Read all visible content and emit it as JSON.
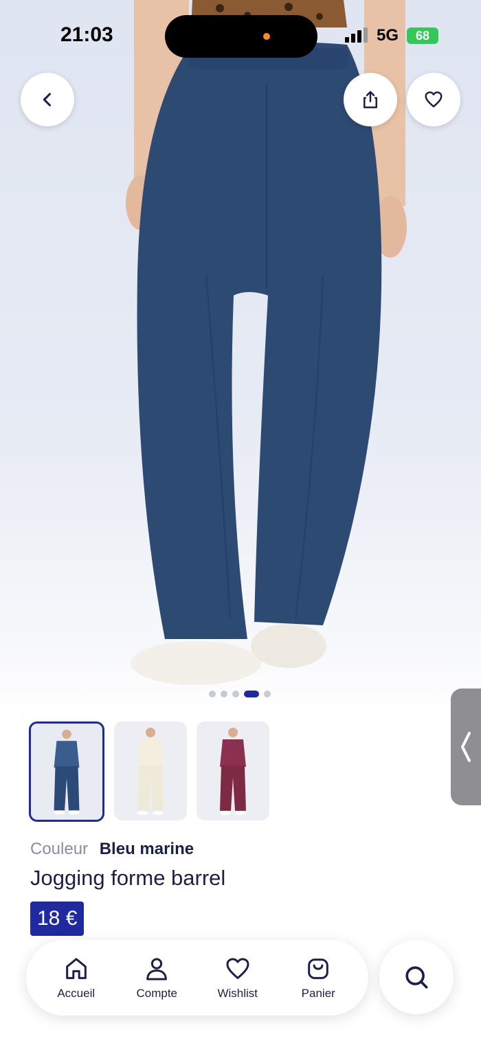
{
  "status_bar": {
    "time": "21:03",
    "network": "5G",
    "battery": "68"
  },
  "header": {
    "back_icon": "chevron-left-icon",
    "share_icon": "share-icon",
    "wishlist_icon": "heart-icon"
  },
  "gallery": {
    "total_slides": 5,
    "active_slide": 4
  },
  "variants": [
    {
      "name": "navy",
      "color": "#2b4a78",
      "top": "#3a5c8f",
      "selected": true
    },
    {
      "name": "cream",
      "color": "#efe9d8",
      "top": "#f3eede",
      "selected": false
    },
    {
      "name": "burgundy",
      "color": "#7e2a45",
      "top": "#8b3050",
      "selected": false
    }
  ],
  "product": {
    "color_label": "Couleur",
    "color_value": "Bleu marine",
    "title": "Jogging forme barrel",
    "price": "18 €"
  },
  "nav": {
    "items": [
      {
        "label": "Accueil",
        "icon": "home-icon"
      },
      {
        "label": "Compte",
        "icon": "user-icon"
      },
      {
        "label": "Wishlist",
        "icon": "heart-icon"
      },
      {
        "label": "Panier",
        "icon": "bag-icon"
      }
    ],
    "search_icon": "search-icon"
  },
  "colors": {
    "accent": "#1f2a9e",
    "text": "#1c1f4a",
    "pants": "#2d4a73"
  }
}
